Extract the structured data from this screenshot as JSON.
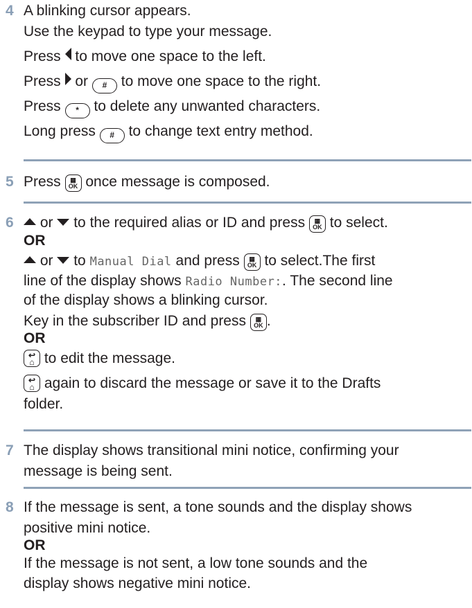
{
  "colors": {
    "step_number": "#8a9fb6",
    "rule": "#8fa2b7",
    "text": "#231f20"
  },
  "icons": {
    "hash_key": "#",
    "star_key": "*",
    "ok_key_top": "▦",
    "ok_key_bottom": "OK",
    "back_key_top": "↩",
    "back_key_bottom": "⌂"
  },
  "step4": {
    "number": "4",
    "line1": "A blinking cursor appears.",
    "line2": "Use the keypad to type your message.",
    "line3_a": "Press",
    "line3_b": "to move one space to the left.",
    "line4_a": "Press",
    "line4_b": "or",
    "line4_c": "to move one space to the right.",
    "line5_a": "Press",
    "line5_b": "to delete any unwanted characters.",
    "line6_a": "Long press",
    "line6_b": "to change text entry method."
  },
  "step5": {
    "number": "5",
    "a": "Press",
    "b": "once message is composed."
  },
  "step6": {
    "number": "6",
    "l1_a": "or",
    "l1_b": "to the required alias or ID and press",
    "l1_c": "to select.",
    "or1": "OR",
    "l2_a": "or",
    "l2_b": "to",
    "l2_mono1": "Manual Dial",
    "l2_c": "and press",
    "l2_d": "to select.The first",
    "l3_a": "line of the display shows",
    "l3_mono": "Radio Number:",
    "l3_b": ". The second line",
    "l4": "of the display shows a blinking cursor.",
    "l5_a": "Key in the subscriber ID and press",
    "l5_b": ".",
    "or2": "OR",
    "l6": "to edit the message.",
    "l7": "again to discard the message or save it to the Drafts",
    "l8": "folder."
  },
  "step7": {
    "number": "7",
    "l1": "The display shows transitional mini notice, confirming your",
    "l2": "message is being sent."
  },
  "step8": {
    "number": "8",
    "l1": "If the message is sent, a tone sounds and the display shows",
    "l2": "positive mini notice.",
    "or": "OR",
    "l3": "If the message is not sent, a low tone sounds and the",
    "l4": "display shows negative mini notice."
  }
}
